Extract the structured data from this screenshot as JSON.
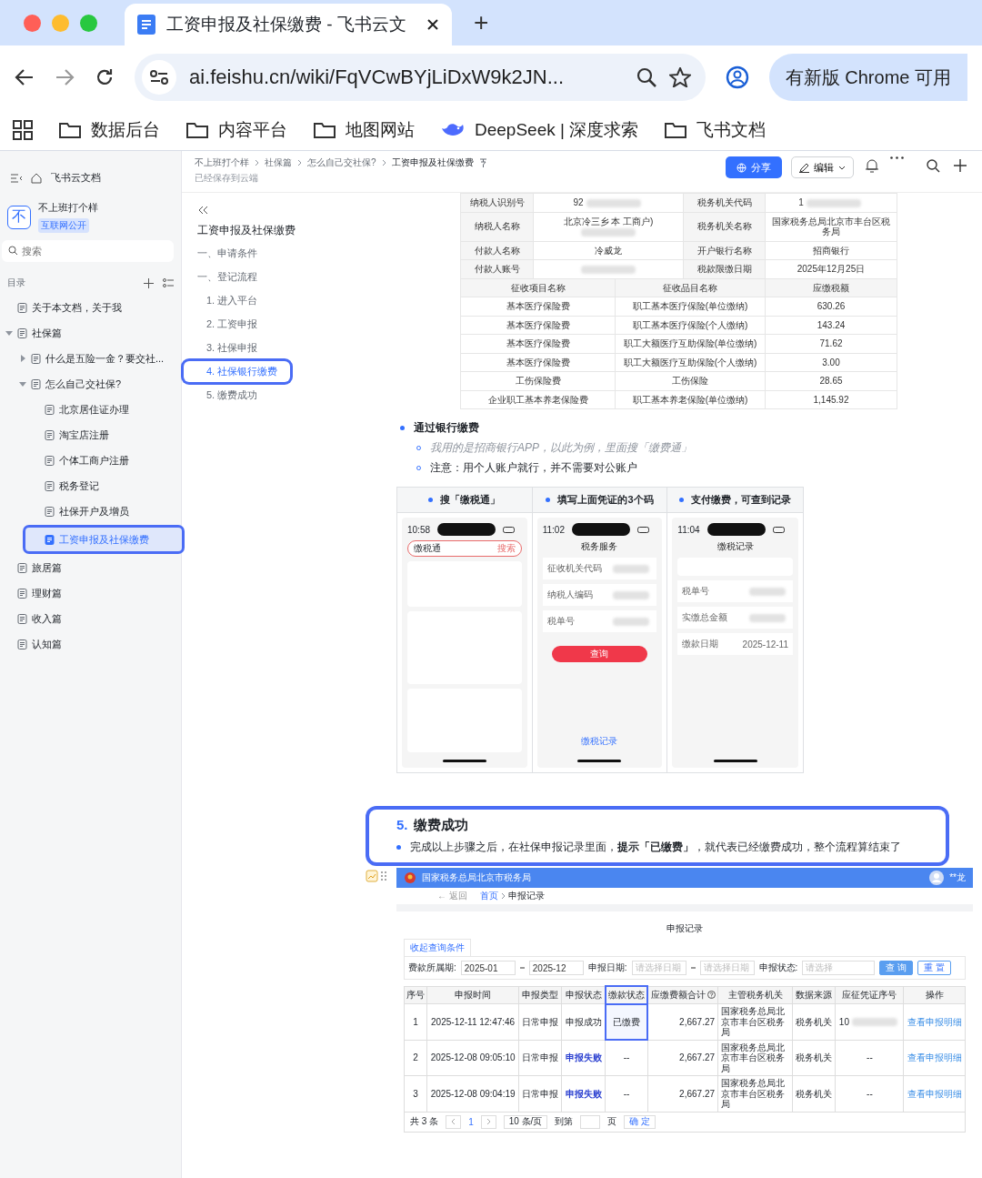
{
  "browser": {
    "tab": {
      "title": "工资申报及社保缴费 - 飞书云文"
    },
    "new_tab": "+",
    "url": "ai.feishu.cn/wiki/FqVCwBYjLiDxW9k2JN...",
    "update_button": "有新版 Chrome 可用",
    "bookmarks": [
      {
        "label": "数据后台",
        "kind": "folder"
      },
      {
        "label": "内容平台",
        "kind": "folder"
      },
      {
        "label": "地图网站",
        "kind": "folder"
      },
      {
        "label": "DeepSeek | 深度求索",
        "kind": "whale"
      },
      {
        "label": "飞书文档",
        "kind": "folder"
      }
    ]
  },
  "sidebar": {
    "home": "飞书云文档",
    "space": {
      "avatar": "不",
      "name": "不上班打个样",
      "badge": "互联网公开"
    },
    "search": {
      "placeholder": "搜索"
    },
    "toc_label": "目录",
    "tree": [
      {
        "label": "关于本文档，关于我",
        "selected": false,
        "highlighted": false
      },
      {
        "label": "社保篇",
        "selected": false,
        "highlighted": false,
        "expanded": true,
        "children": [
          {
            "label": "什么是五险一金？要交社...",
            "selected": false,
            "highlighted": false,
            "expanded": false
          },
          {
            "label": "怎么自己交社保?",
            "selected": false,
            "highlighted": false,
            "expanded": true,
            "children": [
              {
                "label": "北京居住证办理",
                "selected": false,
                "highlighted": false
              },
              {
                "label": "淘宝店注册",
                "selected": false,
                "highlighted": false
              },
              {
                "label": "个体工商户注册",
                "selected": false,
                "highlighted": false
              },
              {
                "label": "税务登记",
                "selected": false,
                "highlighted": false
              },
              {
                "label": "社保开户及增员",
                "selected": false,
                "highlighted": false
              },
              {
                "label": "工资申报及社保缴费",
                "selected": true,
                "highlighted": true
              }
            ]
          }
        ]
      },
      {
        "label": "旅居篇",
        "selected": false,
        "highlighted": false
      },
      {
        "label": "理财篇",
        "selected": false,
        "highlighted": false
      },
      {
        "label": "收入篇",
        "selected": false,
        "highlighted": false
      },
      {
        "label": "认知篇",
        "selected": false,
        "highlighted": false
      }
    ]
  },
  "header": {
    "breadcrumb": [
      "不上班打个样",
      "社保篇",
      "怎么自己交社保?",
      "工资申报及社保缴费"
    ],
    "saved": "已经保存到云端",
    "share": "分享",
    "edit": "编辑"
  },
  "outline": {
    "title": "工资申报及社保缴费",
    "items": [
      {
        "label": "一、申请条件",
        "selected": false,
        "highlighted": false
      },
      {
        "label": "一、登记流程",
        "selected": false,
        "highlighted": false,
        "children": [
          {
            "label": "1. 进入平台",
            "selected": false,
            "highlighted": false
          },
          {
            "label": "2. 工资申报",
            "selected": false,
            "highlighted": false
          },
          {
            "label": "3. 社保申报",
            "selected": false,
            "highlighted": false
          },
          {
            "label": "4. 社保银行缴费",
            "selected": true,
            "highlighted": true
          },
          {
            "label": "5. 缴费成功",
            "selected": false,
            "highlighted": false
          }
        ]
      }
    ]
  },
  "receipt": {
    "info_rows": [
      [
        {
          "text": "纳税人识别号"
        },
        {
          "text": "92",
          "blurred": true
        },
        {
          "text": "税务机关代码"
        },
        {
          "text": "1",
          "blurred": true
        }
      ],
      [
        {
          "text": "纳税人名称"
        },
        {
          "text": "北京冷三乡 本 工商户)",
          "blurred": true
        },
        {
          "text": "税务机关名称"
        },
        {
          "text": "国家税务总局北京市丰台区税务局"
        }
      ],
      [
        {
          "text": "付款人名称"
        },
        {
          "text": "冷威龙"
        },
        {
          "text": "开户银行名称"
        },
        {
          "text": "招商银行"
        }
      ],
      [
        {
          "text": "付款人账号"
        },
        {
          "blurred": true
        },
        {
          "text": "税款限缴日期"
        },
        {
          "text": "2025年12月25日"
        }
      ]
    ],
    "columns": [
      "征收项目名称",
      "征收品目名称",
      "应缴税额"
    ],
    "rows": [
      [
        "基本医疗保险费",
        "职工基本医疗保险(单位缴纳)",
        "630.26"
      ],
      [
        "基本医疗保险费",
        "职工基本医疗保险(个人缴纳)",
        "143.24"
      ],
      [
        "基本医疗保险费",
        "职工大额医疗互助保险(单位缴纳)",
        "71.62"
      ],
      [
        "基本医疗保险费",
        "职工大额医疗互助保险(个人缴纳)",
        "3.00"
      ],
      [
        "工伤保险费",
        "工伤保险",
        "28.65"
      ],
      [
        "企业职工基本养老保险费",
        "职工基本养老保险(单位缴纳)",
        "1,145.92"
      ]
    ]
  },
  "bank_section": {
    "bullet": "通过银行缴费",
    "notes": [
      {
        "text": "我用的是招商银行APP，以此为例，里面搜「缴费通」",
        "kind": "italic"
      },
      {
        "text": "注意：用个人账户就行，并不需要对公账户",
        "kind": "plain"
      }
    ]
  },
  "steps": [
    {
      "caption": "搜「缴税通」",
      "phone": {
        "kind": "search",
        "time": "10:58",
        "search": "缴税通",
        "action": "搜索"
      }
    },
    {
      "caption": "填写上面凭证的3个码",
      "phone": {
        "kind": "form",
        "time": "11:02",
        "title": "税务服务",
        "fields": [
          "征收机关代码",
          "纳税人编码",
          "税单号"
        ],
        "action": "查询",
        "link": "缴税记录"
      }
    },
    {
      "caption": "支付缴费，可查到记录",
      "phone": {
        "kind": "record",
        "time": "11:04",
        "title": "缴税记录",
        "fields": [
          "税单号",
          "实缴总金额",
          "缴款日期"
        ],
        "value": "2025-12-11"
      }
    }
  ],
  "success_section": {
    "number": "5.",
    "title": "缴费成功",
    "highlighted": true,
    "bullet": "完成以上步骤之后，在社保申报记录里面，**提示「已缴费」**，就代表已经缴费成功，整个流程算结束了"
  },
  "tax_page": {
    "agency": "国家税务总局北京市税务局",
    "user": "**龙",
    "back": "← 返回",
    "crumbs": [
      "首页",
      "申报记录"
    ],
    "title": "申报记录",
    "filter_tab": "收起查询条件",
    "filters": [
      {
        "label": "费款所属期:",
        "kind": "range",
        "values": [
          "2025-01",
          "2025-12"
        ]
      },
      {
        "label": "申报日期:",
        "kind": "range_empty",
        "values": [
          "请选择日期",
          "请选择日期"
        ]
      },
      {
        "label": "申报状态:",
        "kind": "select",
        "values": [
          "请选择"
        ]
      }
    ],
    "buttons": [
      {
        "label": "查 询",
        "kind": "primary"
      },
      {
        "label": "重 置",
        "kind": "secondary"
      }
    ],
    "columns": [
      {
        "label": "序号",
        "highlighted": false
      },
      {
        "label": "申报时间",
        "highlighted": false
      },
      {
        "label": "申报类型",
        "highlighted": false
      },
      {
        "label": "申报状态",
        "highlighted": false
      },
      {
        "label": "缴款状态",
        "highlighted": true
      },
      {
        "label": "应缴费额合计",
        "highlighted": false,
        "help": true
      },
      {
        "label": "主管税务机关",
        "highlighted": false
      },
      {
        "label": "数据来源",
        "highlighted": false
      },
      {
        "label": "应征凭证序号",
        "highlighted": false
      },
      {
        "label": "操作",
        "highlighted": false
      }
    ],
    "rows": [
      {
        "no": "1",
        "time": "2025-12-11 12:47:46",
        "type": "日常申报",
        "status": {
          "text": "申报成功",
          "kind": "success"
        },
        "payment": {
          "text": "已缴费",
          "highlighted": true
        },
        "amount": "2,667.27",
        "office": "国家税务总局北京市丰台区税务局",
        "source": "税务机关",
        "voucher": {
          "text": "10",
          "blurred": true
        },
        "action": "查看申报明细"
      },
      {
        "no": "2",
        "time": "2025-12-08 09:05:10",
        "type": "日常申报",
        "status": {
          "text": "申报失败",
          "kind": "failed"
        },
        "payment": {
          "text": "--",
          "highlighted": false
        },
        "amount": "2,667.27",
        "office": "国家税务总局北京市丰台区税务局",
        "source": "税务机关",
        "voucher": {
          "text": "--",
          "blurred": false
        },
        "action": "查看申报明细"
      },
      {
        "no": "3",
        "time": "2025-12-08 09:04:19",
        "type": "日常申报",
        "status": {
          "text": "申报失败",
          "kind": "failed"
        },
        "payment": {
          "text": "--",
          "highlighted": false
        },
        "amount": "2,667.27",
        "office": "国家税务总局北京市丰台区税务局",
        "source": "税务机关",
        "voucher": {
          "text": "--",
          "blurred": false
        },
        "action": "查看申报明细"
      }
    ],
    "pager": {
      "total": "共 3 条",
      "page": "1",
      "size": "10 条/页",
      "goto": "到第",
      "unit": "页",
      "confirm": "确 定"
    }
  }
}
